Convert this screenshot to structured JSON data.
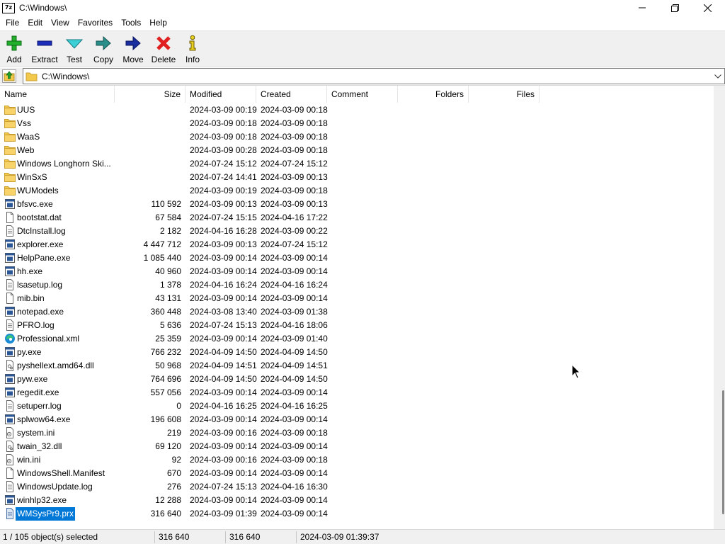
{
  "window": {
    "title": "C:\\Windows\\",
    "app_icon_text": "7z"
  },
  "menu": [
    "File",
    "Edit",
    "View",
    "Favorites",
    "Tools",
    "Help"
  ],
  "toolbar": {
    "add": "Add",
    "extract": "Extract",
    "test": "Test",
    "copy": "Copy",
    "move": "Move",
    "delete": "Delete",
    "info": "Info"
  },
  "address": {
    "path": "C:\\Windows\\"
  },
  "columns": {
    "name": "Name",
    "size": "Size",
    "modified": "Modified",
    "created": "Created",
    "comment": "Comment",
    "folders": "Folders",
    "files": "Files"
  },
  "files": [
    {
      "name": "UUS",
      "type": "folder",
      "size": "",
      "modified": "2024-03-09 00:19",
      "created": "2024-03-09 00:18"
    },
    {
      "name": "Vss",
      "type": "folder",
      "size": "",
      "modified": "2024-03-09 00:18",
      "created": "2024-03-09 00:18"
    },
    {
      "name": "WaaS",
      "type": "folder",
      "size": "",
      "modified": "2024-03-09 00:18",
      "created": "2024-03-09 00:18"
    },
    {
      "name": "Web",
      "type": "folder",
      "size": "",
      "modified": "2024-03-09 00:28",
      "created": "2024-03-09 00:18"
    },
    {
      "name": "Windows Longhorn Ski...",
      "type": "folder",
      "size": "",
      "modified": "2024-07-24 15:12",
      "created": "2024-07-24 15:12"
    },
    {
      "name": "WinSxS",
      "type": "folder",
      "size": "",
      "modified": "2024-07-24 14:41",
      "created": "2024-03-09 00:13"
    },
    {
      "name": "WUModels",
      "type": "folder",
      "size": "",
      "modified": "2024-03-09 00:19",
      "created": "2024-03-09 00:18"
    },
    {
      "name": "bfsvc.exe",
      "type": "exe",
      "size": "110 592",
      "modified": "2024-03-09 00:13",
      "created": "2024-03-09 00:13"
    },
    {
      "name": "bootstat.dat",
      "type": "file",
      "size": "67 584",
      "modified": "2024-07-24 15:15",
      "created": "2024-04-16 17:22"
    },
    {
      "name": "DtcInstall.log",
      "type": "text",
      "size": "2 182",
      "modified": "2024-04-16 16:28",
      "created": "2024-03-09 00:22"
    },
    {
      "name": "explorer.exe",
      "type": "exe",
      "size": "4 447 712",
      "modified": "2024-03-09 00:13",
      "created": "2024-07-24 15:12"
    },
    {
      "name": "HelpPane.exe",
      "type": "exe",
      "size": "1 085 440",
      "modified": "2024-03-09 00:14",
      "created": "2024-03-09 00:14"
    },
    {
      "name": "hh.exe",
      "type": "exe",
      "size": "40 960",
      "modified": "2024-03-09 00:14",
      "created": "2024-03-09 00:14"
    },
    {
      "name": "lsasetup.log",
      "type": "text",
      "size": "1 378",
      "modified": "2024-04-16 16:24",
      "created": "2024-04-16 16:24"
    },
    {
      "name": "mib.bin",
      "type": "file",
      "size": "43 131",
      "modified": "2024-03-09 00:14",
      "created": "2024-03-09 00:14"
    },
    {
      "name": "notepad.exe",
      "type": "exe",
      "size": "360 448",
      "modified": "2024-03-08 13:40",
      "created": "2024-03-09 01:38"
    },
    {
      "name": "PFRO.log",
      "type": "text",
      "size": "5 636",
      "modified": "2024-07-24 15:13",
      "created": "2024-04-16 18:06"
    },
    {
      "name": "Professional.xml",
      "type": "edge",
      "size": "25 359",
      "modified": "2024-03-09 00:14",
      "created": "2024-03-09 01:40"
    },
    {
      "name": "py.exe",
      "type": "exe",
      "size": "766 232",
      "modified": "2024-04-09 14:50",
      "created": "2024-04-09 14:50"
    },
    {
      "name": "pyshellext.amd64.dll",
      "type": "dll",
      "size": "50 968",
      "modified": "2024-04-09 14:51",
      "created": "2024-04-09 14:51"
    },
    {
      "name": "pyw.exe",
      "type": "exe",
      "size": "764 696",
      "modified": "2024-04-09 14:50",
      "created": "2024-04-09 14:50"
    },
    {
      "name": "regedit.exe",
      "type": "exe",
      "size": "557 056",
      "modified": "2024-03-09 00:14",
      "created": "2024-03-09 00:14"
    },
    {
      "name": "setuperr.log",
      "type": "text",
      "size": "0",
      "modified": "2024-04-16 16:25",
      "created": "2024-04-16 16:25"
    },
    {
      "name": "splwow64.exe",
      "type": "exe",
      "size": "196 608",
      "modified": "2024-03-09 00:14",
      "created": "2024-03-09 00:14"
    },
    {
      "name": "system.ini",
      "type": "ini",
      "size": "219",
      "modified": "2024-03-09 00:16",
      "created": "2024-03-09 00:18"
    },
    {
      "name": "twain_32.dll",
      "type": "dll",
      "size": "69 120",
      "modified": "2024-03-09 00:14",
      "created": "2024-03-09 00:14"
    },
    {
      "name": "win.ini",
      "type": "ini",
      "size": "92",
      "modified": "2024-03-09 00:16",
      "created": "2024-03-09 00:18"
    },
    {
      "name": "WindowsShell.Manifest",
      "type": "file",
      "size": "670",
      "modified": "2024-03-09 00:14",
      "created": "2024-03-09 00:14"
    },
    {
      "name": "WindowsUpdate.log",
      "type": "text",
      "size": "276",
      "modified": "2024-07-24 15:13",
      "created": "2024-04-16 16:30"
    },
    {
      "name": "winhlp32.exe",
      "type": "exe",
      "size": "12 288",
      "modified": "2024-03-09 00:14",
      "created": "2024-03-09 00:14"
    },
    {
      "name": "WMSysPr9.prx",
      "type": "prx",
      "size": "316 640",
      "modified": "2024-03-09 01:39",
      "created": "2024-03-09 00:14",
      "selected": true
    }
  ],
  "status": {
    "selection": "1 / 105 object(s) selected",
    "size": "316 640",
    "packed": "316 640",
    "modified": "2024-03-09 01:39:37"
  },
  "colors": {
    "selection": "#0078d7",
    "folder": "#e8b84a",
    "exe_blue": "#2b5797"
  }
}
